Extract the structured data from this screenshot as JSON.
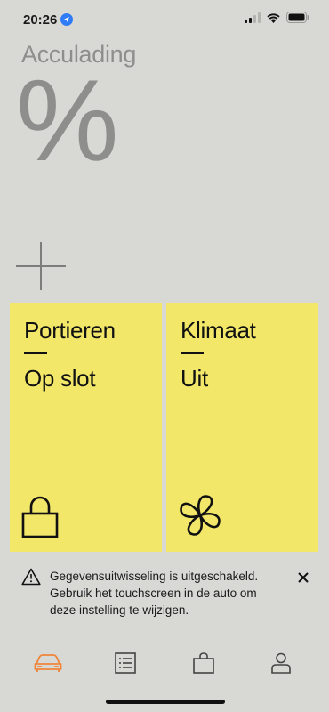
{
  "status_bar": {
    "time": "20:26",
    "icons": [
      "location-arrow-icon",
      "cellular-signal-icon",
      "wifi-icon",
      "battery-icon"
    ]
  },
  "charge": {
    "label": "Acculading",
    "value": "%"
  },
  "add_button": {
    "icon": "plus-icon"
  },
  "tiles": [
    {
      "title": "Portieren",
      "status": "Op slot",
      "icon": "padlock-icon"
    },
    {
      "title": "Klimaat",
      "status": "Uit",
      "icon": "fan-icon"
    }
  ],
  "notice": {
    "icon": "warning-triangle-icon",
    "text": "Gegevensuitwisseling is uitgeschakeld. Gebruik het touchscreen in de auto om deze instelling te wijzigen.",
    "close_icon": "close-icon"
  },
  "tab_bar": {
    "tabs": [
      {
        "icon": "car-icon",
        "active": true
      },
      {
        "icon": "list-icon",
        "active": false
      },
      {
        "icon": "shopping-bag-icon",
        "active": false
      },
      {
        "icon": "profile-icon",
        "active": false
      }
    ]
  },
  "colors": {
    "background": "#d8d8d5",
    "tile": "#f3e76a",
    "accent": "#f0853a",
    "muted_text": "#8e8e8c"
  }
}
